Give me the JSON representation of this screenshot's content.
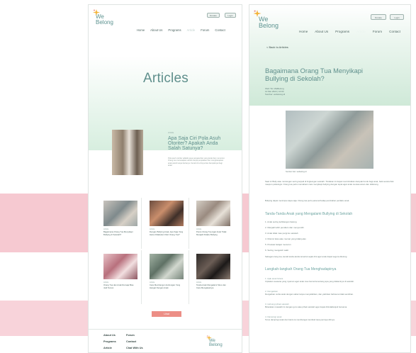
{
  "brand": {
    "line1": "We",
    "line2": "Belong"
  },
  "header": {
    "donate_label": "Donate",
    "login_label": "Login"
  },
  "nav": [
    "Home",
    "About Us",
    "Programs",
    "Article",
    "Forum",
    "Contact"
  ],
  "articles_page": {
    "title": "Articles",
    "featured": {
      "category": "Article",
      "title": "Apa Saja Ciri Pola Asuh Otoriter? Apakah Anda Salah Satunya?",
      "desc": "Pola asuh otoriter adalah gaya pengasuhan yang ketat dan menuntut. Orang tua menetapkan aturan tanpa penjelasan dan mengharapkan anak patuh tanpa bertanya. Kenali ciri-cirinya dan dampaknya bagi anak."
    },
    "cards": [
      {
        "category": "Article",
        "title": "Bagaimana Orang Tua Menyikapi Bullying di Sekolah?"
      },
      {
        "category": "Article",
        "title": "Dengan Bullying Anak, Apa Saja Yang Harus Dilakukan Oleh Orang Tua?"
      },
      {
        "category": "Article",
        "title": "Peran Orang Tua Agar Anak Tidak Menjadi Pelaku Bullying"
      },
      {
        "category": "Article",
        "title": "Orang Tua dan Anak Remaja Bisa Jadi Teman"
      },
      {
        "category": "Article",
        "title": "Cara Membangun Hubungan Yang Hangat Dengan Anak"
      },
      {
        "category": "Article",
        "title": "Tanda Anak Mengalami Stres dan Cara Mengatasinya"
      }
    ],
    "more_label": "Lihat",
    "footer_links": [
      "About Us",
      "Programs",
      "Article",
      "Forum",
      "Contact",
      "Chat With Us"
    ]
  },
  "article_detail": {
    "back_label": "< Back to Articles",
    "title": "Bagaimana Orang Tua Menyikapi Bullying di Sekolah?",
    "meta_author": "Oleh Tim WeBelong",
    "meta_date": "12 Mei 2022 | 10:00",
    "meta_source": "Sumber: webelong.id",
    "caption": "Sumber foto: webelong.id",
    "paragraph1": "Saat ini Bully atau rundungan sering terjadi di lingkungan sekolah. Tindakan ini dapat menimbulkan dampak buruk bagi anak, baik secara fisik maupun psikologis. Orang tua perlu memahami cara menyikapi bullying dengan tepat agar anak merasa aman dan didukung.",
    "paragraph2": "Bullying dapat menimpa siapa saja. Orang tua perlu peka terhadap perubahan perilaku anak.",
    "subheading1": "Tanda-Tanda Anak yang Mengalami Bullying di Sekolah",
    "list": [
      "1. Anak sering kehilangan barang",
      "2. Menjadi lebih pendiam dan menyendiri",
      "3. Anak tidak mau pergi ke sekolah",
      "4. Muncul luka atau memar yang tidak jelas",
      "5. Prestasi belajar menurun",
      "6. Sering mengeluh sakit"
    ],
    "paragraph3": "Sebagai orang tua, kenali tanda-tanda tersebut sejak dini agar anak dapat segera ditolong.",
    "subheading2": "Langkah-langkah Orang Tua Menghadapinya",
    "steps": [
      {
        "heading": "1. Ajak anak bicara",
        "text": "Ciptakan suasana yang nyaman agar anak mau bercerita tentang apa yang dialaminya di sekolah."
      },
      {
        "heading": "2. Dengarkan",
        "text": "Dengarkan cerita anak dengan sabar tanpa menyalahkan, dan yakinkan bahwa ia tidak sendirian."
      },
      {
        "heading": "3. Hubungi pihak sekolah",
        "text": "Bicarakan masalah ini dengan guru atau pihak sekolah agar dapat ditindaklanjuti bersama."
      },
      {
        "heading": "4. Dampingi anak",
        "text": "Terus dampingi anak dan bantu ia membangun kembali rasa percaya dirinya."
      }
    ]
  }
}
